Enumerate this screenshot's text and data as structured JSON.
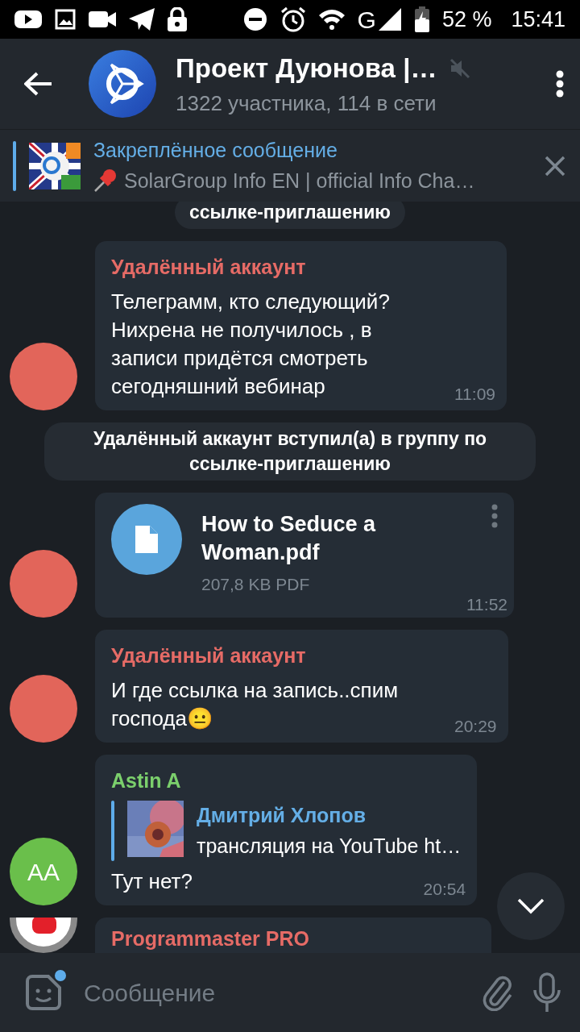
{
  "status_bar": {
    "network": "G",
    "battery": "52 %",
    "time": "15:41"
  },
  "header": {
    "title": "Проект Дуюнова |…",
    "subtitle": "1322 участника, 114 в сети",
    "muted": true
  },
  "pinned": {
    "label": "Закреплённое сообщение",
    "text": "SolarGroup Info EN | official Info Cha…"
  },
  "messages": [
    {
      "kind": "service",
      "text": "ссылке-приглашению"
    },
    {
      "kind": "text",
      "sender": "Удалённый аккаунт",
      "color": "#e66b66",
      "avatar": {
        "kind": "plain",
        "color": "#e2655a"
      },
      "text": "Телеграмм, кто следующий? Нихрена не получилось , в записи придётся смотреть сегодняшний вебинар",
      "time": "11:09"
    },
    {
      "kind": "service",
      "text": "Удалённый аккаунт вступил(а) в группу по ссылке-приглашению"
    },
    {
      "kind": "file",
      "avatar": {
        "kind": "plain",
        "color": "#e2655a"
      },
      "file_name": "How to Seduce a Woman.pdf",
      "file_info": "207,8 KB PDF",
      "time": "11:52"
    },
    {
      "kind": "text",
      "sender": "Удалённый аккаунт",
      "color": "#e66b66",
      "avatar": {
        "kind": "plain",
        "color": "#e2655a"
      },
      "text": "И где ссылка на запись..спим господа😐",
      "time": "20:29"
    },
    {
      "kind": "reply",
      "sender": "Astin A",
      "color": "#7bcf6c",
      "avatar": {
        "kind": "initials",
        "initials": "AA",
        "color": "#6abf4b"
      },
      "reply": {
        "author": "Дмитрий Хлопов",
        "text": "трансляция на YouTube  ht…"
      },
      "text": "Тут нет?",
      "time": "20:54"
    },
    {
      "kind": "cut",
      "sender": "Programmaster PRO",
      "color": "#e66b66",
      "avatar": {
        "kind": "logo",
        "color": "#ffffff"
      }
    }
  ],
  "composer": {
    "placeholder": "Сообщение",
    "emoji_badge": true
  }
}
